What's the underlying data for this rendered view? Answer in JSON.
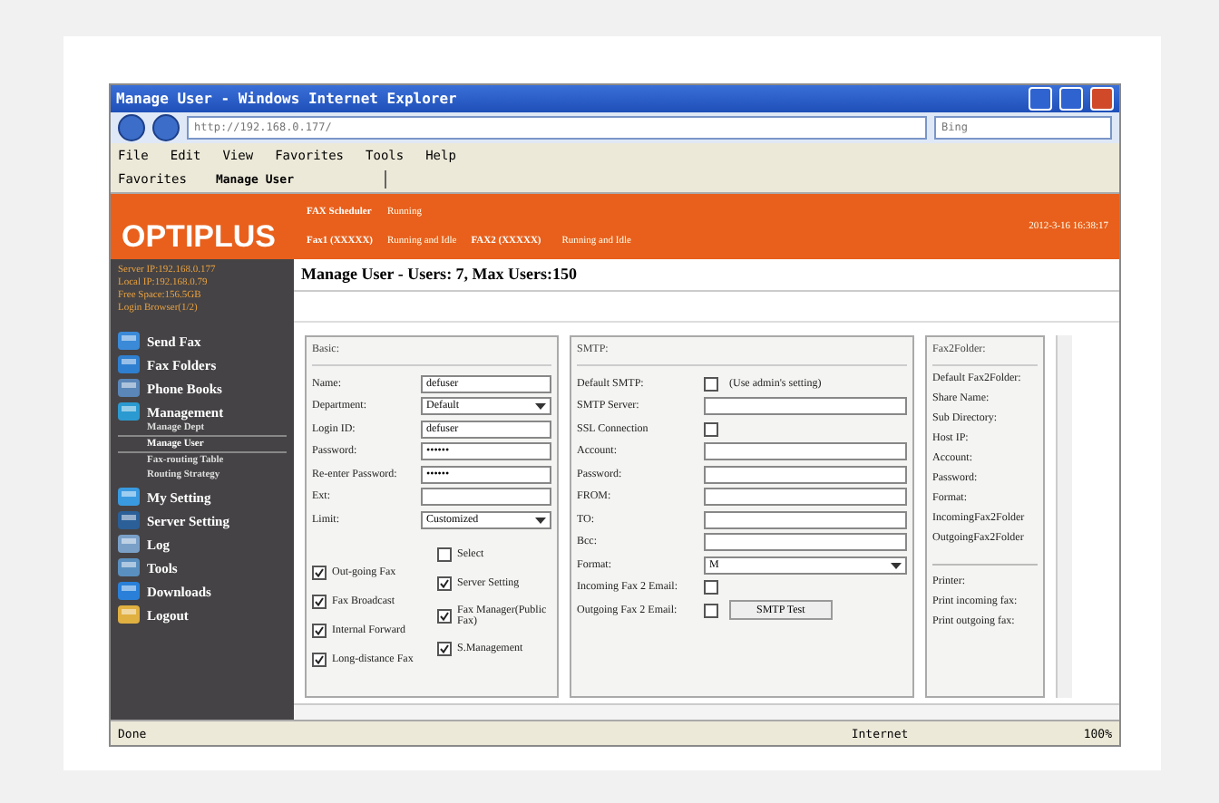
{
  "window": {
    "title": "Manage User - Windows Internet Explorer",
    "address": "http://192.168.0.177/",
    "search": {
      "placeholder": "Bing"
    }
  },
  "menu": [
    "File",
    "Edit",
    "View",
    "Favorites",
    "Tools",
    "Help"
  ],
  "favorites": {
    "label": "Favorites",
    "tab": "Manage User"
  },
  "header": {
    "logo": "OPTIPLUS",
    "status": [
      {
        "name": "FAX Scheduler",
        "state": "Running"
      },
      {
        "name": "Fax1 (XXXXX)",
        "state": "Running and Idle"
      },
      {
        "name": "FAX2 (XXXXX)",
        "state": "Running and Idle"
      }
    ],
    "datetime": "2012-3-16 16:38:17"
  },
  "sidebar": {
    "info": [
      "Server IP:192.168.0.177",
      "Local IP:192.168.0.79",
      "Free Space:156.5GB",
      "Login Browser(1/2)"
    ],
    "items": [
      {
        "label": "Send Fax",
        "color": "#3a8ad8"
      },
      {
        "label": "Fax Folders",
        "color": "#2f7fd0"
      },
      {
        "label": "Phone Books",
        "color": "#5a86b8"
      },
      {
        "label": "Management",
        "color": "#2b9ad0",
        "children": [
          {
            "label": "Manage Dept",
            "selected": false
          },
          {
            "label": "Manage User",
            "selected": true
          },
          {
            "label": "Fax-routing Table",
            "selected": false
          },
          {
            "label": "Routing Strategy",
            "selected": false
          }
        ]
      },
      {
        "label": "My Setting",
        "color": "#3a9ae0"
      },
      {
        "label": "Server Setting",
        "color": "#2a5f98"
      },
      {
        "label": "Log",
        "color": "#7aa0c8"
      },
      {
        "label": "Tools",
        "color": "#5a90c0"
      },
      {
        "label": "Downloads",
        "color": "#2a80d8"
      },
      {
        "label": "Logout",
        "color": "#e0b040"
      }
    ]
  },
  "page_title": "Manage User - Users: 7, Max Users:150",
  "basic": {
    "title": "Basic:",
    "fields": [
      {
        "label": "Name:",
        "kind": "text",
        "value": "defuser"
      },
      {
        "label": "Department:",
        "kind": "select",
        "value": "Default"
      },
      {
        "label": "Login ID:",
        "kind": "text",
        "value": "defuser"
      },
      {
        "label": "Password:",
        "kind": "password",
        "value": "••••••"
      },
      {
        "label": "Re-enter Password:",
        "kind": "password",
        "value": "••••••"
      },
      {
        "label": "Ext:",
        "kind": "text"
      },
      {
        "label": "Limit:",
        "kind": "select",
        "value": "Customized"
      }
    ],
    "permissions_left": [
      {
        "label": "Out-going Fax",
        "checked": true
      },
      {
        "label": "Fax Broadcast",
        "checked": true
      },
      {
        "label": "Internal Forward",
        "checked": true
      },
      {
        "label": "Long-distance Fax",
        "checked": true
      }
    ],
    "permissions_right": [
      {
        "label": "Select",
        "checked": false
      },
      {
        "label": "Server Setting",
        "checked": true
      },
      {
        "label": "Fax Manager(Public Fax)",
        "checked": true
      },
      {
        "label": "S.Management",
        "checked": true
      }
    ]
  },
  "smtp": {
    "title": "SMTP:",
    "fields": [
      {
        "label": "Default SMTP:",
        "kind": "check",
        "checked": false,
        "note": "(Use admin's setting)"
      },
      {
        "label": "SMTP Server:",
        "kind": "text"
      },
      {
        "label": "SSL Connection",
        "kind": "check",
        "checked": false
      },
      {
        "label": "Account:",
        "kind": "text"
      },
      {
        "label": "Password:",
        "kind": "text"
      },
      {
        "label": "FROM:",
        "kind": "text"
      },
      {
        "label": "TO:",
        "kind": "text"
      },
      {
        "label": "Bcc:",
        "kind": "text"
      },
      {
        "label": "Format:",
        "kind": "select",
        "value": "M"
      },
      {
        "label": "Incoming Fax 2 Email:",
        "kind": "check",
        "checked": false
      },
      {
        "label": "Outgoing Fax 2 Email:",
        "kind": "check",
        "checked": false,
        "button": "SMTP Test"
      }
    ]
  },
  "fax2folder": {
    "title": "Fax2Folder:",
    "fields": [
      "Default Fax2Folder:",
      "Share Name:",
      "Sub Directory:",
      "Host IP:",
      "Account:",
      "Password:",
      "Format:",
      "IncomingFax2Folder",
      "OutgoingFax2Folder"
    ],
    "printer": [
      "Printer:",
      "Print incoming fax:",
      "Print outgoing fax:"
    ]
  },
  "status_bar": {
    "text": "Done",
    "zone": "Internet",
    "zoom": "100%"
  }
}
